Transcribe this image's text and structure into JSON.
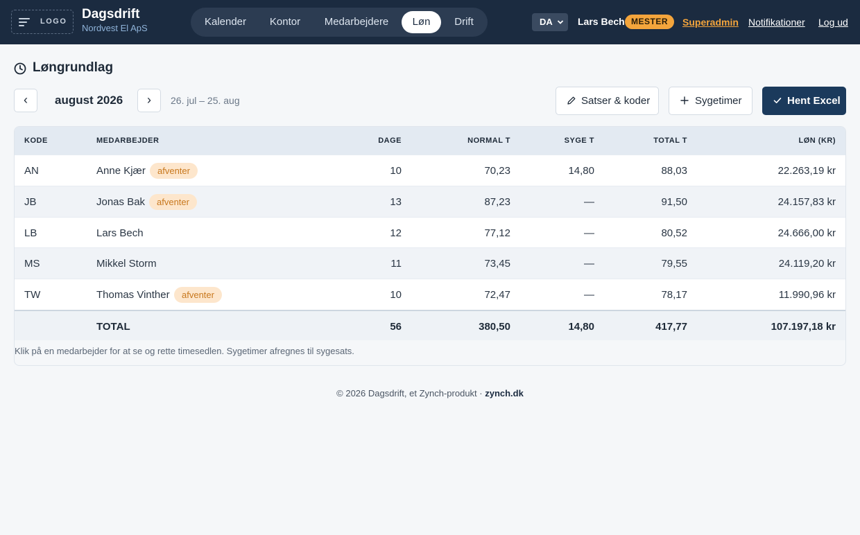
{
  "header": {
    "logo_text": "LOGO",
    "brand_title": "Dagsdrift",
    "brand_subtitle": "Nordvest El ApS",
    "nav": [
      {
        "label": "Kalender",
        "active": false
      },
      {
        "label": "Kontor",
        "active": false
      },
      {
        "label": "Medarbejdere",
        "active": false
      },
      {
        "label": "Løn",
        "active": true
      },
      {
        "label": "Drift",
        "active": false
      }
    ],
    "language": "DA",
    "user_name": "Lars Bech",
    "role_badge": "MESTER",
    "links": {
      "superadmin": "Superadmin",
      "notifications": "Notifikationer",
      "logout": "Log ud"
    }
  },
  "page": {
    "title": "Løngrundlag",
    "month": "august 2026",
    "range": "26. jul – 25. aug",
    "prev_icon": "‹",
    "next_icon": "›",
    "buttons": {
      "rates": "Satser & koder",
      "sick_hours": "Sygetimer",
      "export": "Hent Excel"
    }
  },
  "table": {
    "columns": {
      "code": "KODE",
      "employee": "MEDARBEJDER",
      "days": "DAGE",
      "normal": "NORMAL T",
      "sick": "SYGE T",
      "total": "TOTAL T",
      "pay": "LØN (KR)"
    },
    "rows": [
      {
        "code": "AN",
        "name": "Anne Kjær",
        "badge": "afventer",
        "days": "10",
        "normal": "70,23",
        "sick": "14,80",
        "total": "88,03",
        "pay": "22.263,19 kr"
      },
      {
        "code": "JB",
        "name": "Jonas Bak",
        "badge": "afventer",
        "days": "13",
        "normal": "87,23",
        "sick": "—",
        "total": "91,50",
        "pay": "24.157,83 kr"
      },
      {
        "code": "LB",
        "name": "Lars Bech",
        "badge": "",
        "days": "12",
        "normal": "77,12",
        "sick": "—",
        "total": "80,52",
        "pay": "24.666,00 kr"
      },
      {
        "code": "MS",
        "name": "Mikkel Storm",
        "badge": "",
        "days": "11",
        "normal": "73,45",
        "sick": "—",
        "total": "79,55",
        "pay": "24.119,20 kr"
      },
      {
        "code": "TW",
        "name": "Thomas Vinther",
        "badge": "afventer",
        "days": "10",
        "normal": "72,47",
        "sick": "—",
        "total": "78,17",
        "pay": "11.990,96 kr"
      }
    ],
    "totals": {
      "label": "TOTAL",
      "days": "56",
      "normal": "380,50",
      "sick": "14,80",
      "total": "417,77",
      "pay": "107.197,18 kr"
    },
    "hint": "Klik på en medarbejder for at se og rette timesedlen. Sygetimer afregnes til sygesats."
  },
  "footer": {
    "text": "© 2026 Dagsdrift, et Zynch-produkt · ",
    "link": "zynch.dk"
  },
  "colors": {
    "header_bg": "#1b2b40",
    "accent_orange": "#f4a53c",
    "primary_button": "#1b3a5c",
    "badge_bg": "#fde6cc",
    "badge_text": "#c8781e"
  }
}
